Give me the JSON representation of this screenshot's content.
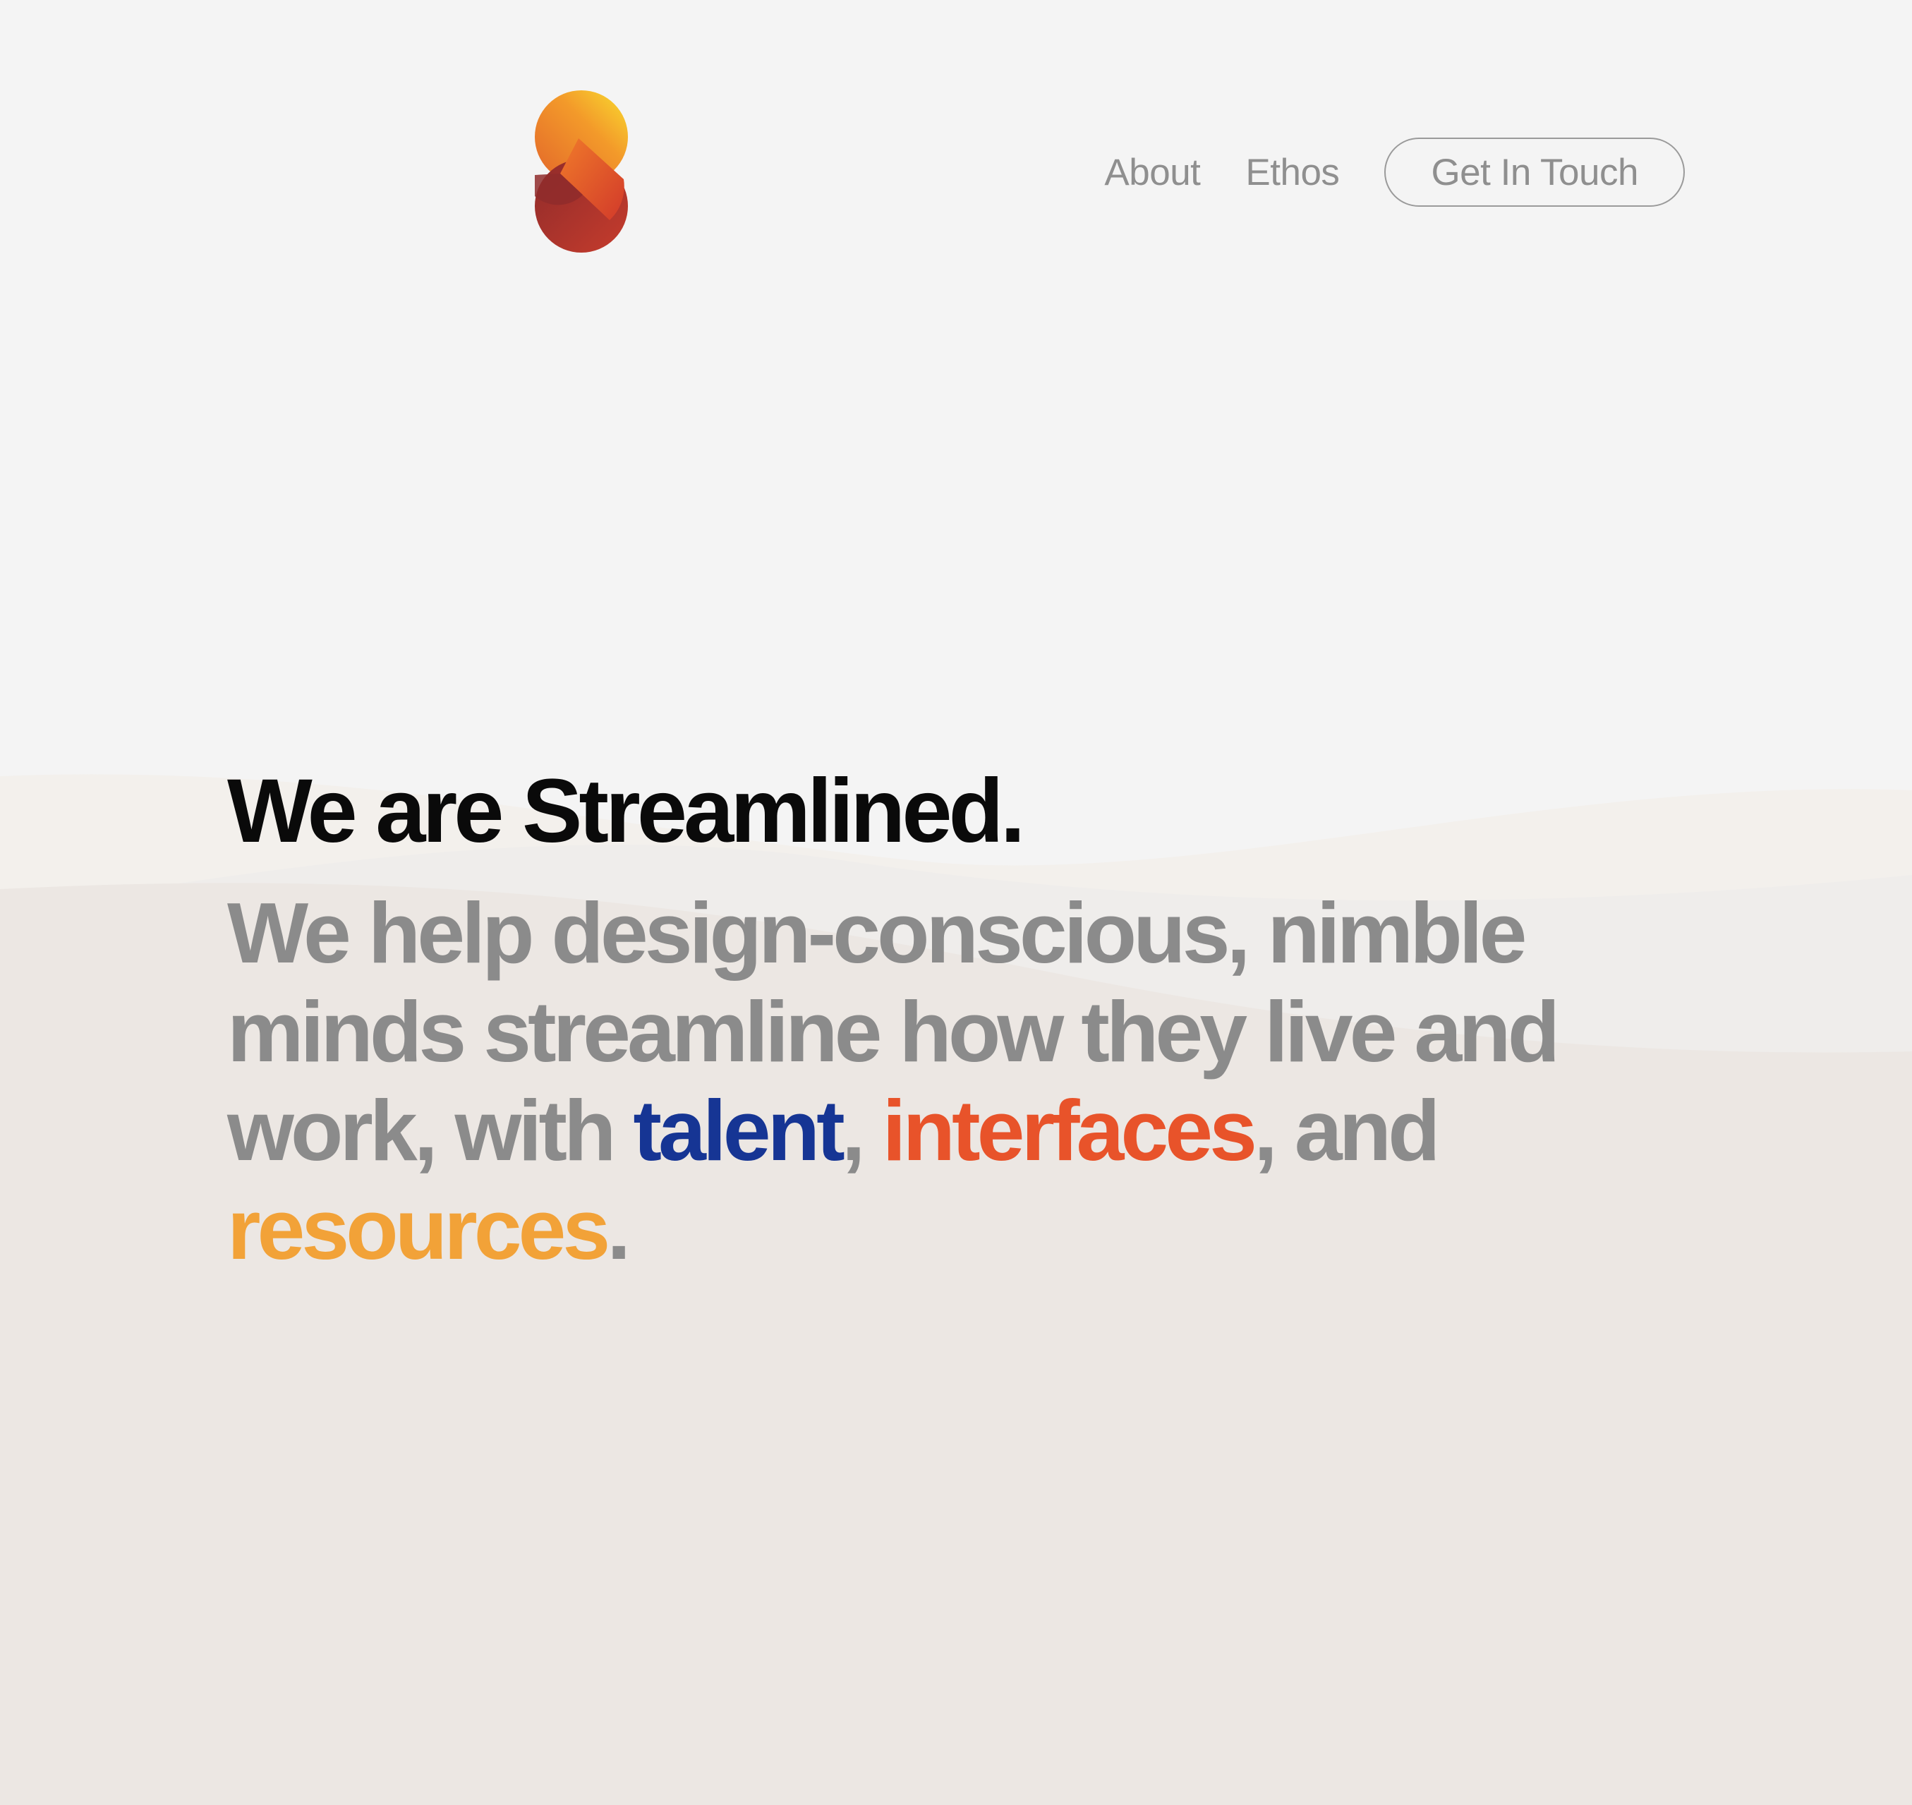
{
  "brand": {
    "logo_icon": "streamlined-s-logo-icon",
    "gradient_colors": [
      "#f9dd2f",
      "#f39a2a",
      "#e2502b",
      "#8f2b2b"
    ]
  },
  "nav": {
    "items": [
      {
        "label": "About"
      },
      {
        "label": "Ethos"
      }
    ],
    "cta_label": "Get In Touch"
  },
  "hero": {
    "title": "We are Streamlined.",
    "text_part1": "We help design-conscious, nimble minds streamline how they live and work, with ",
    "highlight_talent": "talent",
    "separator1": ", ",
    "highlight_interfaces": "interfaces",
    "separator2": ", and ",
    "highlight_resources": "resources",
    "end_punctuation": "."
  },
  "colors": {
    "background": "#f4f4f4",
    "title": "#0a0a0a",
    "body_text": "#8b8b8b",
    "talent": "#163594",
    "interfaces": "#e8532a",
    "resources": "#f2a238"
  }
}
